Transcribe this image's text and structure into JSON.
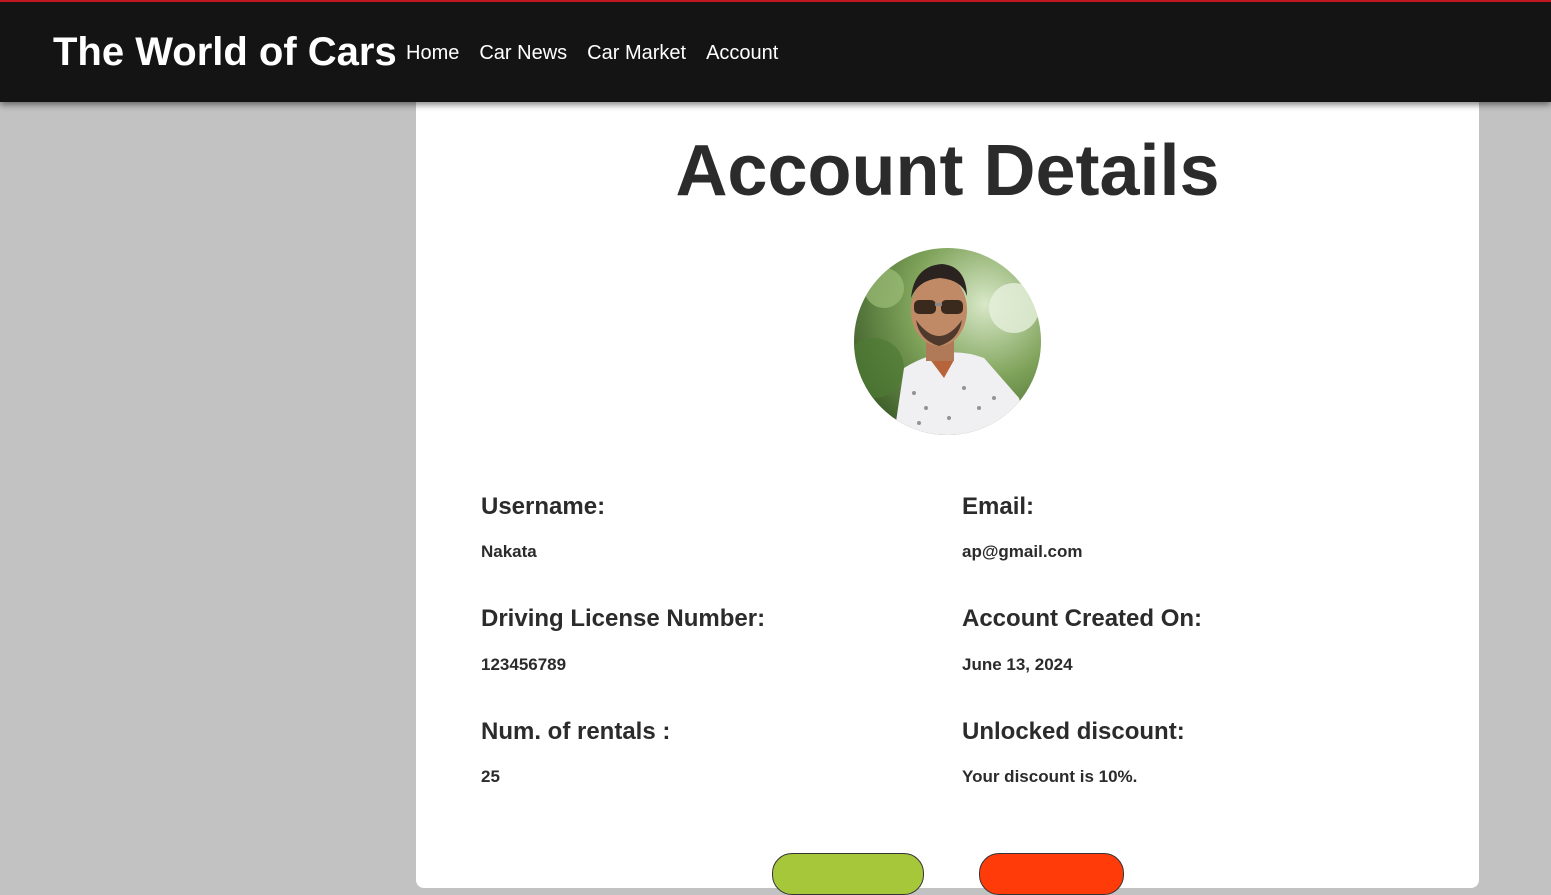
{
  "header": {
    "brand": "The World of Cars",
    "nav": [
      "Home",
      "Car News",
      "Car Market",
      "Account"
    ]
  },
  "main": {
    "title": "Account Details",
    "fields": {
      "username": {
        "label": "Username:",
        "value": "Nakata"
      },
      "email": {
        "label": "Email:",
        "value": "ap@gmail.com"
      },
      "license": {
        "label": "Driving License Number:",
        "value": "123456789"
      },
      "created": {
        "label": "Account Created On:",
        "value": "June 13, 2024"
      },
      "rentals": {
        "label": "Num. of rentals :",
        "value": "25"
      },
      "discount": {
        "label": "Unlocked discount:",
        "value": "Your discount is 10%."
      }
    }
  },
  "colors": {
    "accent_bar": "#c0161f",
    "header_bg": "#141414",
    "edit_button": "#a7c73a",
    "delete_button": "#ff3b0a"
  }
}
